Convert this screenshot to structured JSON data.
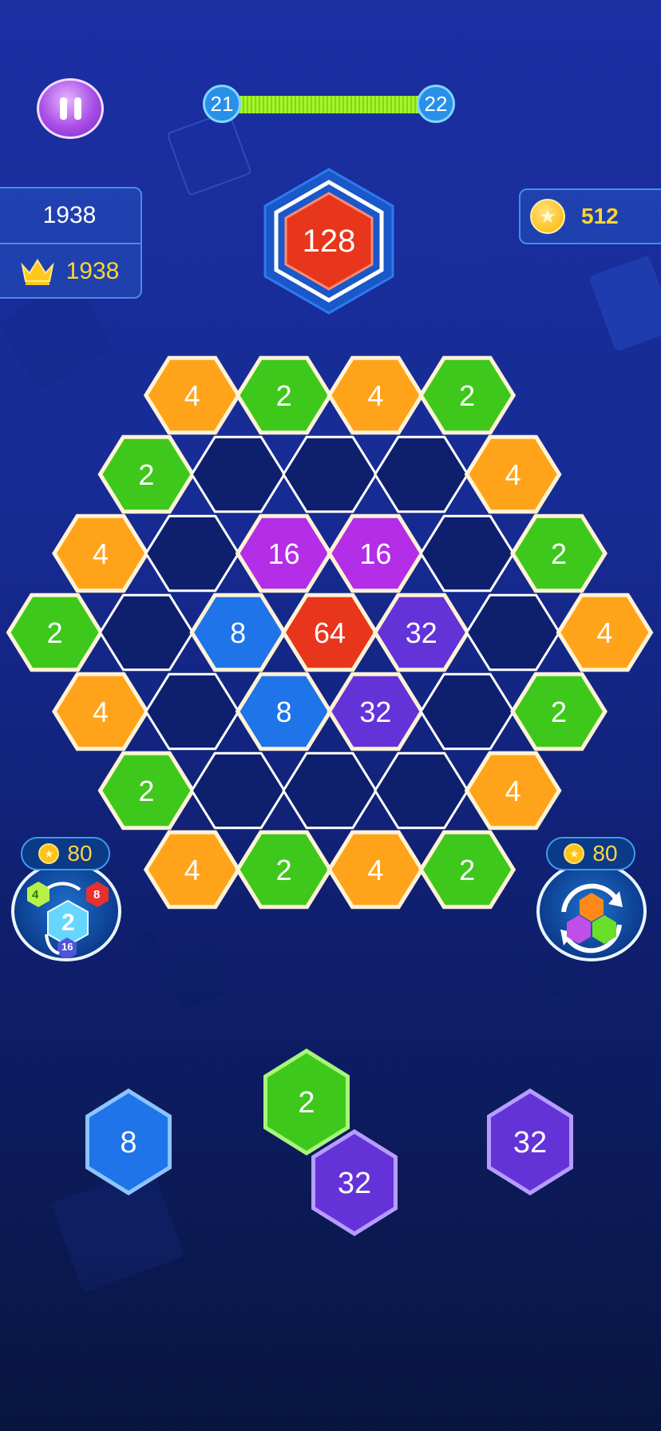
{
  "top_bar": {
    "level_current": "21",
    "level_next": "22",
    "level_progress": 1.0
  },
  "score_panel": {
    "score": "1938",
    "best": "1938"
  },
  "coins": {
    "amount": "512"
  },
  "target_tile": {
    "value": "128"
  },
  "colors": {
    "2": "#3ec81c",
    "4": "#ffa41a",
    "8": "#1e74e8",
    "16": "#b32ee6",
    "32": "#6433d8",
    "64": "#e8361c",
    "128": "#e8361c"
  },
  "board": [
    "4",
    "2",
    "4",
    "2",
    "2",
    "",
    "",
    "",
    "4",
    "4",
    "",
    "16",
    "16",
    "",
    "2",
    "2",
    "",
    "8",
    "64",
    "32",
    "",
    "4",
    "4",
    "",
    "8",
    "32",
    "",
    "2",
    "2",
    "",
    "",
    "",
    "4",
    "4",
    "2",
    "4",
    "2"
  ],
  "boosters": {
    "left": {
      "cost": "80",
      "icon": "swap-number-icon",
      "hex_labels": [
        "4",
        "8",
        "2",
        "16"
      ]
    },
    "right": {
      "cost": "80",
      "icon": "shuffle-icon"
    }
  },
  "pieces": [
    {
      "tiles": [
        "8"
      ]
    },
    {
      "tiles": [
        "2",
        "32"
      ]
    },
    {
      "tiles": [
        "32"
      ]
    }
  ]
}
